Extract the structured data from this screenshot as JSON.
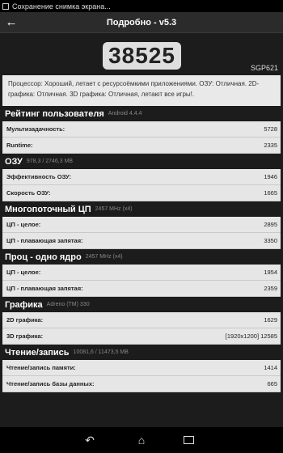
{
  "statusbar": {
    "notification": "Сохранение снимка экрана..."
  },
  "titlebar": {
    "back_icon": "←",
    "title": "Подробно - v5.3"
  },
  "score": {
    "value": "38525",
    "device": "SGP621"
  },
  "summary": "Процессор: Хороший, летает с ресурсоёмкими приложениями. ОЗУ: Отличная. 2D-графика: Отличная. 3D графика: Отличная, летают все игры!.",
  "sections": [
    {
      "title": "Рейтинг пользователя",
      "sub": "Android 4.4.4",
      "rows": [
        {
          "label": "Мультизадачность:",
          "value": "5728"
        },
        {
          "label": "Runtime:",
          "value": "2335"
        }
      ]
    },
    {
      "title": "ОЗУ",
      "sub": "978,3 / 2746,3 MB",
      "rows": [
        {
          "label": "Эффективность ОЗУ:",
          "value": "1946"
        },
        {
          "label": "Скорость ОЗУ:",
          "value": "1665"
        }
      ]
    },
    {
      "title": "Многопоточный ЦП",
      "sub": "2457 MHz (x4)",
      "rows": [
        {
          "label": "ЦП - целое:",
          "value": "2895"
        },
        {
          "label": "ЦП - плавающая запятая:",
          "value": "3350"
        }
      ]
    },
    {
      "title": "Проц - одно ядро",
      "sub": "2457 MHz (x4)",
      "rows": [
        {
          "label": "ЦП - целое:",
          "value": "1954"
        },
        {
          "label": "ЦП - плавающая запятая:",
          "value": "2359"
        }
      ]
    },
    {
      "title": "Графика",
      "sub": "Adreno (TM) 330",
      "rows": [
        {
          "label": "2D графика:",
          "value": "1629"
        },
        {
          "label": "3D графика:",
          "value": "[1920x1200] 12585"
        }
      ]
    },
    {
      "title": "Чтение/запись",
      "sub": "10081,6 / 11473,5 MB",
      "rows": [
        {
          "label": "Чтение/запись памяти:",
          "value": "1414"
        },
        {
          "label": "Чтение/запись базы данных:",
          "value": "665"
        }
      ]
    }
  ],
  "navbar": {
    "back_icon": "↶",
    "home_icon": "⌂",
    "recents_icon": "recents"
  }
}
